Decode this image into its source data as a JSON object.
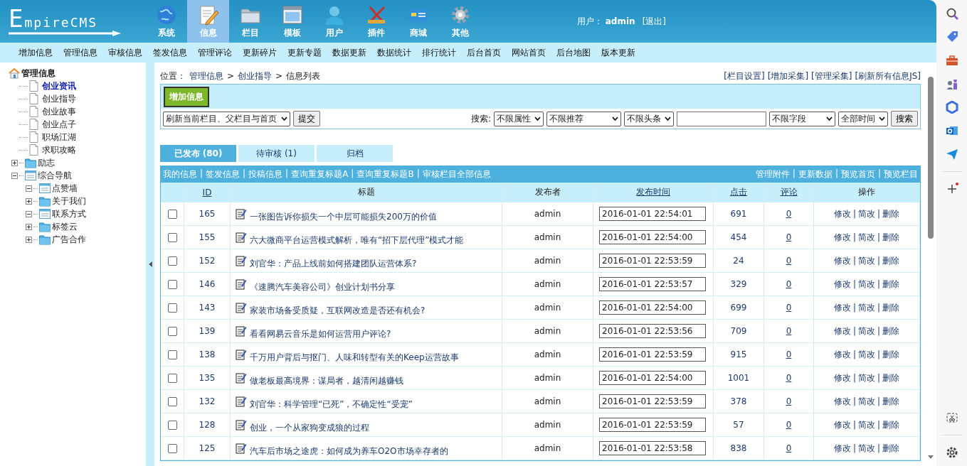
{
  "header": {
    "logo": "EmpireCMS",
    "modules": [
      {
        "label": "系统",
        "selected": false
      },
      {
        "label": "信息",
        "selected": true
      },
      {
        "label": "栏目",
        "selected": false
      },
      {
        "label": "模板",
        "selected": false
      },
      {
        "label": "用户",
        "selected": false
      },
      {
        "label": "插件",
        "selected": false
      },
      {
        "label": "商城",
        "selected": false
      },
      {
        "label": "其他",
        "selected": false
      }
    ],
    "user_label": "用户：",
    "user_name": "admin",
    "logout": "[退出]"
  },
  "menu": [
    "增加信息",
    "管理信息",
    "审核信息",
    "签发信息",
    "管理评论",
    "更新碎片",
    "更新专题",
    "数据更新",
    "数据统计",
    "排行统计",
    "后台首页",
    "网站首页",
    "后台地图",
    "版本更新"
  ],
  "tree": {
    "root": "管理信息",
    "items": [
      {
        "label": "创业资讯",
        "kind": "page",
        "selected": true
      },
      {
        "label": "创业指导",
        "kind": "page",
        "selected": false
      },
      {
        "label": "创业故事",
        "kind": "page",
        "selected": false
      },
      {
        "label": "创业点子",
        "kind": "page",
        "selected": false
      },
      {
        "label": "职场江湖",
        "kind": "page",
        "selected": false
      },
      {
        "label": "求职攻略",
        "kind": "page",
        "selected": false
      },
      {
        "label": "励志",
        "kind": "folder",
        "selected": false,
        "expanded": false
      },
      {
        "label": "综合导航",
        "kind": "list",
        "selected": false,
        "expanded": true,
        "children": [
          {
            "label": "点赞墙",
            "kind": "list",
            "selected": false,
            "expanded": true
          },
          {
            "label": "关于我们",
            "kind": "folder",
            "selected": false,
            "expanded": false
          },
          {
            "label": "联系方式",
            "kind": "list",
            "selected": false,
            "expanded": true
          },
          {
            "label": "标签云",
            "kind": "folder",
            "selected": false,
            "expanded": false
          },
          {
            "label": "广告合作",
            "kind": "folder",
            "selected": false,
            "expanded": false
          }
        ]
      }
    ]
  },
  "breadcrumb": {
    "prefix": "位置：",
    "separator": ">",
    "items": [
      "管理信息",
      "创业指导",
      "信息列表"
    ]
  },
  "top_links": [
    "[栏目设置]",
    "[增加采集]",
    "[管理采集]",
    "[刷新所有信息JS]"
  ],
  "add_button": "增加信息",
  "refresh": {
    "select": "刷新当前栏目、父栏目与首页",
    "button": "提交"
  },
  "search": {
    "label": "搜索:",
    "filters": [
      "不限属性",
      "不限推荐",
      "不限头条"
    ],
    "field_select": "不限字段",
    "time_select": "全部时间",
    "button": "搜索"
  },
  "tabs": [
    {
      "label": "已发布 (80)",
      "selected": true
    },
    {
      "label": "待审核 (1)",
      "selected": false
    },
    {
      "label": "归档",
      "selected": false
    }
  ],
  "link_separator": "|",
  "links_left": [
    "我的信息",
    "签发信息",
    "投稿信息",
    "查询重复标题A",
    "查询重复标题B",
    "审核栏目全部信息"
  ],
  "links_right": [
    "管理附件",
    "更新数据",
    "预览首页",
    "预览栏目"
  ],
  "table": {
    "columns": [
      {
        "label": "ID",
        "sortable": true
      },
      {
        "label": "标题",
        "sortable": false
      },
      {
        "label": "发布者",
        "sortable": false
      },
      {
        "label": "发布时间",
        "sortable": true
      },
      {
        "label": "点击",
        "sortable": true
      },
      {
        "label": "评论",
        "sortable": true
      },
      {
        "label": "操作",
        "sortable": false
      }
    ],
    "rows": [
      {
        "checked": false,
        "id": "165",
        "title": "一张图告诉你损失一个中层可能损失200万的价值",
        "author": "admin",
        "time": "2016-01-01 22:54:01",
        "clicks": "691",
        "comments": "0",
        "actions": [
          "修改",
          "简改",
          "删除"
        ]
      },
      {
        "checked": false,
        "id": "155",
        "title": "六大微商平台运营模式解析，唯有“招下层代理”模式才能",
        "author": "admin",
        "time": "2016-01-01 22:54:00",
        "clicks": "454",
        "comments": "0",
        "actions": [
          "修改",
          "简改",
          "删除"
        ]
      },
      {
        "checked": false,
        "id": "152",
        "title": "刘官华：产品上线前如何搭建团队运营体系?",
        "author": "admin",
        "time": "2016-01-01 22:53:59",
        "clicks": "24",
        "comments": "0",
        "actions": [
          "修改",
          "简改",
          "删除"
        ]
      },
      {
        "checked": false,
        "id": "146",
        "title": "《速腾汽车美容公司》创业计划书分享",
        "author": "admin",
        "time": "2016-01-01 22:53:57",
        "clicks": "329",
        "comments": "0",
        "actions": [
          "修改",
          "简改",
          "删除"
        ]
      },
      {
        "checked": false,
        "id": "143",
        "title": "家装市场备受质疑，互联网改造是否还有机会?",
        "author": "admin",
        "time": "2016-01-01 22:54:00",
        "clicks": "699",
        "comments": "0",
        "actions": [
          "修改",
          "简改",
          "删除"
        ]
      },
      {
        "checked": false,
        "id": "139",
        "title": "看看网易云音乐是如何运营用户评论?",
        "author": "admin",
        "time": "2016-01-01 22:53:56",
        "clicks": "709",
        "comments": "0",
        "actions": [
          "修改",
          "简改",
          "删除"
        ]
      },
      {
        "checked": false,
        "id": "138",
        "title": "千万用户背后与抠门、人味和转型有关的Keep运营故事",
        "author": "admin",
        "time": "2016-01-01 22:53:59",
        "clicks": "915",
        "comments": "0",
        "actions": [
          "修改",
          "简改",
          "删除"
        ]
      },
      {
        "checked": false,
        "id": "135",
        "title": "做老板最高境界：谋局者，越清闲越赚钱",
        "author": "admin",
        "time": "2016-01-01 22:54:00",
        "clicks": "1001",
        "comments": "0",
        "actions": [
          "修改",
          "简改",
          "删除"
        ]
      },
      {
        "checked": false,
        "id": "132",
        "title": "刘官华：科学管理“已死”，不确定性“受宠”",
        "author": "admin",
        "time": "2016-01-01 22:53:59",
        "clicks": "378",
        "comments": "0",
        "actions": [
          "修改",
          "简改",
          "删除"
        ]
      },
      {
        "checked": false,
        "id": "128",
        "title": "创业，一个从家狗变成狼的过程",
        "author": "admin",
        "time": "2016-01-01 22:53:59",
        "clicks": "57",
        "comments": "0",
        "actions": [
          "修改",
          "简改",
          "删除"
        ]
      },
      {
        "checked": false,
        "id": "125",
        "title": "汽车后市场之途虎：如何成为养车O2O市场幸存者的",
        "author": "admin",
        "time": "2016-01-01 22:53:58",
        "clicks": "838",
        "comments": "0",
        "actions": [
          "修改",
          "简改",
          "删除"
        ]
      }
    ]
  }
}
